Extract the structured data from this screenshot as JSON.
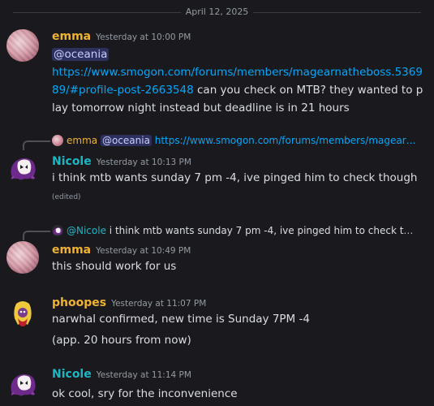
{
  "date_divider": "April 12, 2025",
  "messages": [
    {
      "username": "emma",
      "timestamp": "Yesterday at 10:00 PM",
      "mention": "@oceania",
      "link": "https://www.smogon.com/forums/members/magearnatheboss.536989/#profile-post-2663548",
      "text": " can you check on MTB? they wanted to play tomorrow night instead but deadline is in 21 hours"
    },
    {
      "reply_user": "emma",
      "reply_mention": "@oceania",
      "reply_link": "https://www.smogon.com/forums/members/magear…",
      "username": "Nicole",
      "timestamp": "Yesterday at 10:13 PM",
      "text": "i think mtb wants sunday 7 pm -4, ive pinged him to check though",
      "edited": "(edited)"
    },
    {
      "reply_user": "@Nicole",
      "reply_text": "i think mtb wants sunday 7 pm -4, ive pinged him to check tho…",
      "username": "emma",
      "timestamp": "Yesterday at 10:49 PM",
      "text": "this should work for us"
    },
    {
      "username": "phoopes",
      "timestamp": "Yesterday at 11:07 PM",
      "text": "narwhal confirmed, new time is Sunday 7PM -4",
      "text2": "(app. 20 hours from now)"
    },
    {
      "username": "Nicole",
      "timestamp": "Yesterday at 11:14 PM",
      "text": "ok cool, sry for the inconvenience"
    }
  ]
}
